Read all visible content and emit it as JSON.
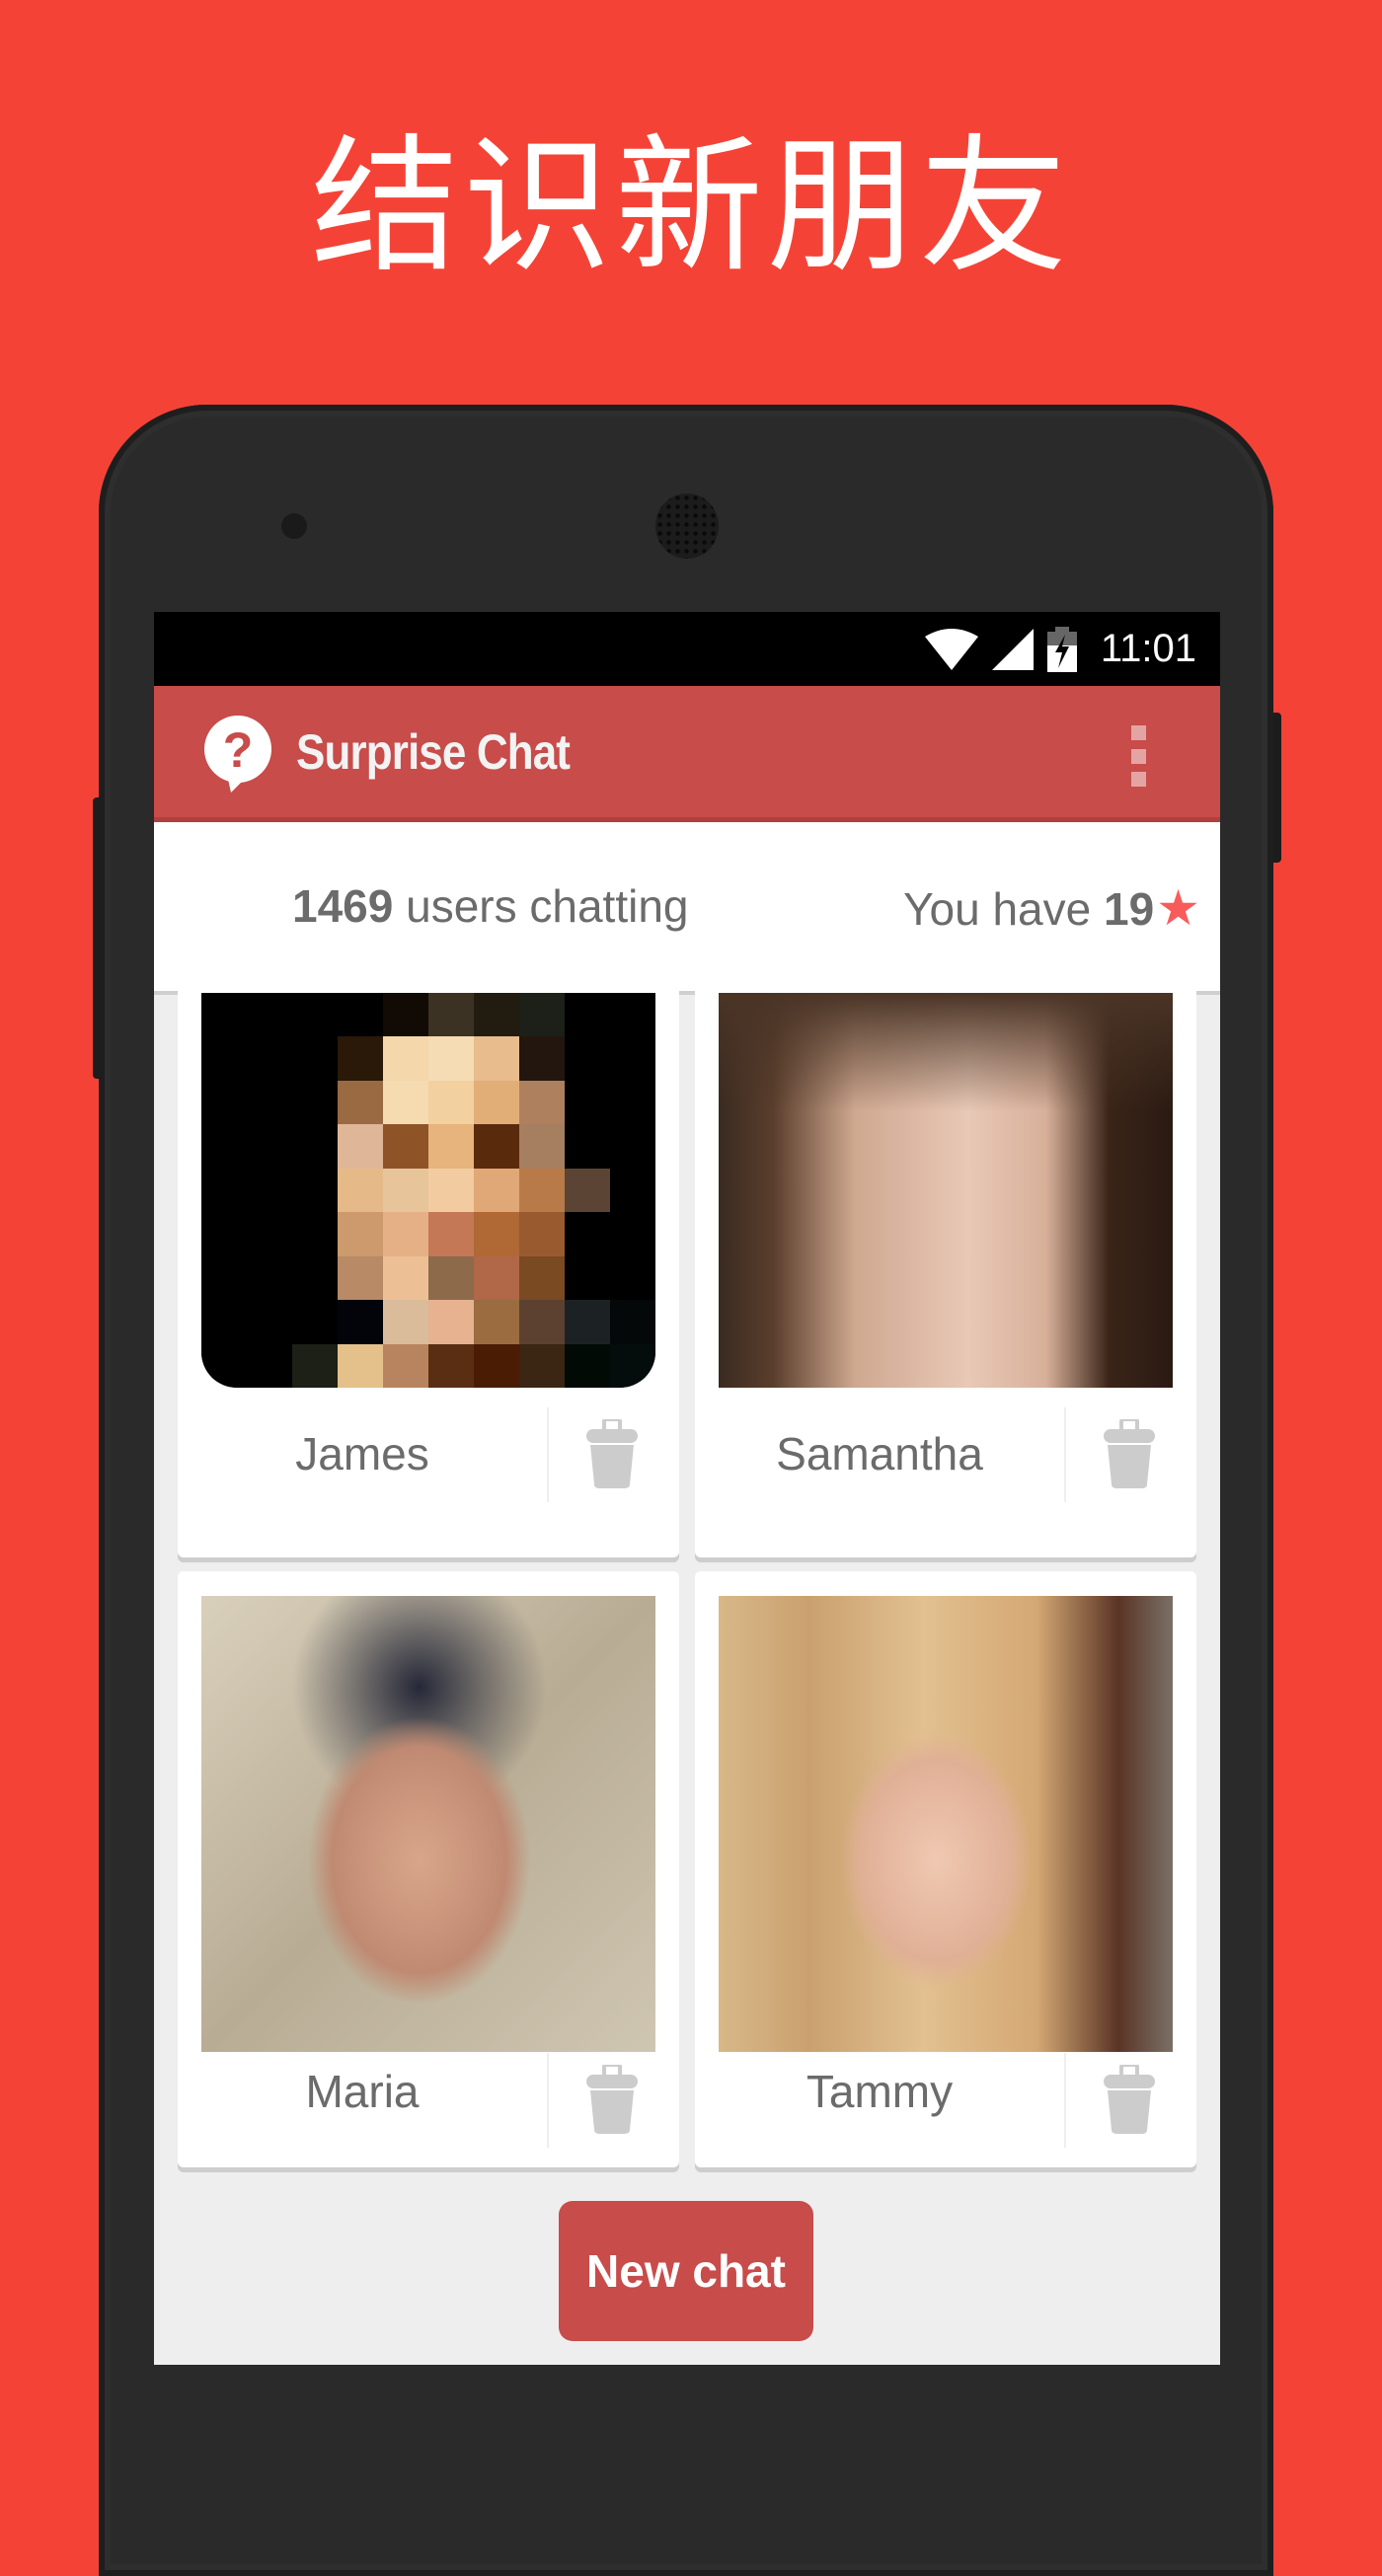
{
  "promo": {
    "headline": "结识新朋友"
  },
  "statusbar": {
    "time": "11:01",
    "icons": [
      "wifi-icon",
      "cell-signal-icon",
      "battery-charging-icon"
    ]
  },
  "appbar": {
    "title": "Surprise Chat",
    "logo_icon": "question-speech-bubble-icon",
    "menu_icon": "overflow-menu-icon"
  },
  "stats": {
    "users_count": "1469",
    "users_label": " users chatting",
    "stars_prefix": "You have ",
    "stars_count": "19",
    "star_icon": "★"
  },
  "colors": {
    "background": "#f44336",
    "primary": "#c74c4a",
    "star": "#f85c5a",
    "text": "#6b6b6b",
    "trash": "#cccccc"
  },
  "contacts": [
    {
      "name": "James",
      "photo": "pixelated-avatar"
    },
    {
      "name": "Samantha",
      "photo": "portrait-brunette-braid"
    },
    {
      "name": "Maria",
      "photo": "portrait-dark-hair-stone-wall"
    },
    {
      "name": "Tammy",
      "photo": "portrait-blonde-braid"
    }
  ],
  "actions": {
    "new_chat_label": "New chat"
  }
}
